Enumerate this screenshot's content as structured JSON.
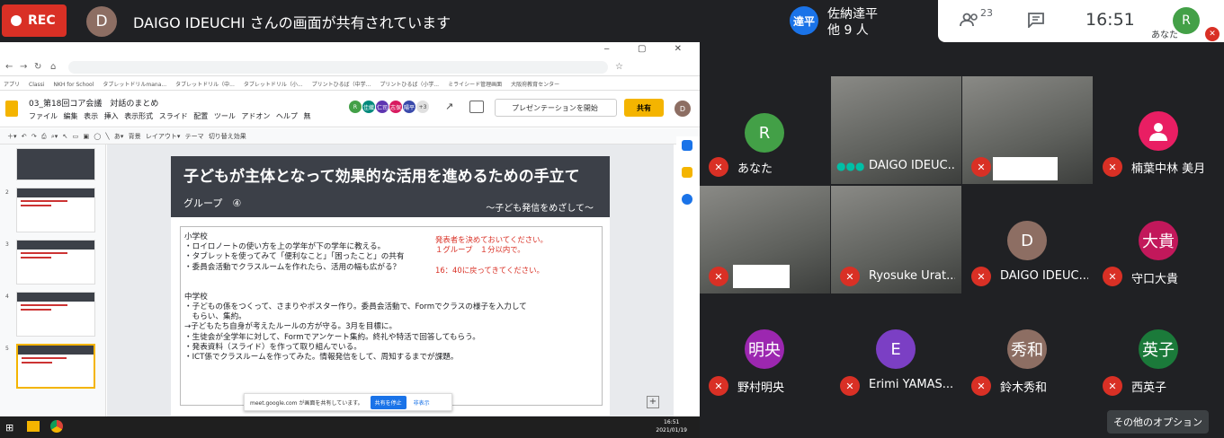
{
  "meet": {
    "rec_label": "REC",
    "presenter_initial": "D",
    "share_text": "DAIGO IDEUCHI さんの画面が共有されています",
    "pinned_badge": "達平",
    "pinned_name": "佐納達平",
    "pinned_others": "他 9 人",
    "people_count": "23",
    "clock": "16:51",
    "self_initial": "R",
    "self_label": "あなた",
    "more_options": "その他のオプション"
  },
  "browser": {
    "bookmarks": [
      "アプリ",
      "Classi",
      "NKH for School",
      "タブレットドリルmana...",
      "タブレットドリル（中...",
      "タブレットドリル（小...",
      "プリントひるば（中学...",
      "プリントひるば（小学...",
      "ミライシード管理画面",
      "大阪府教育センター"
    ]
  },
  "slides_app": {
    "doc_title": "03_第18回コア会議　対話のまとめ",
    "menu": [
      "ファイル",
      "編集",
      "表示",
      "挿入",
      "表示形式",
      "スライド",
      "配置",
      "ツール",
      "アドオン",
      "ヘルプ",
      "無"
    ],
    "collaborators": [
      "R",
      "佳織",
      "仁司",
      "志保",
      "陽平"
    ],
    "collab_extra": "+3",
    "present_label": "プレゼンテーションを開始",
    "share_label": "共有",
    "user_initial": "D",
    "toolbar": [
      "背景",
      "レイアウト▾",
      "テーマ",
      "切り替え効果"
    ],
    "slide_numbers": [
      "2",
      "3",
      "4",
      "5"
    ],
    "slide": {
      "title": "子どもが主体となって効果的な活用を進めるための手立て",
      "group": "グループ　④",
      "subtitle": "～子ども発信をめざして～",
      "body_lines": [
        "小学校",
        "・ロイロノートの使い方を上の学年が下の学年に教える。",
        "・タブレットを使ってみて「便利なこと」「困ったこと」の共有",
        "・委員会活動でクラスルームを作れたら、活用の幅も広がる？",
        "",
        "",
        "中学校",
        "・子どもの係をつくって、さまりやポスター作り。委員会活動で、Formでクラスの様子を入力して",
        "　もらい、集約。",
        "→子どもたち自身が考えたルールの方が守る。3月を目標に。",
        "・生徒会が全学年に対して、Formでアンケート集約。終礼や特活で回答してもらう。",
        "・発表資料（スライド）を作って取り組んでいる。",
        "・ICT係でクラスルームを作ってみた。情報発信をして、周知するまでが課題。"
      ],
      "red_note": "発表者を決めておいてください。\n１グループ　１分以内で。\n\n16：40に戻ってきてください。"
    },
    "share_notice": "meet.google.com が画面を共有しています。",
    "stop_label": "共有を停止",
    "hide_label": "非表示",
    "taskbar_time": "16:51",
    "taskbar_date": "2021/01/19"
  },
  "participants": [
    {
      "name": "あなた",
      "initial": "R",
      "color": "#43a047",
      "type": "avatar"
    },
    {
      "name": "DAIGO IDEUC...",
      "type": "video",
      "speaking": true
    },
    {
      "name": "",
      "type": "video",
      "redacted": true
    },
    {
      "name": "楠葉中林 美月",
      "initial": "",
      "color": "#e91e63",
      "type": "person-icon"
    },
    {
      "name": "",
      "type": "video",
      "redacted": true
    },
    {
      "name": "Ryosuke Urat...",
      "type": "video"
    },
    {
      "name": "DAIGO IDEUC...",
      "initial": "D",
      "color": "#8d6e63",
      "type": "avatar"
    },
    {
      "name": "守口大貴",
      "initial": "大貴",
      "color": "#c2185b",
      "type": "avatar"
    },
    {
      "name": "野村明央",
      "initial": "明央",
      "color": "#9c27b0",
      "type": "avatar"
    },
    {
      "name": "Erimi YAMAS...",
      "initial": "E",
      "color": "#7b3fc4",
      "type": "avatar"
    },
    {
      "name": "鈴木秀和",
      "initial": "秀和",
      "color": "#8d6e63",
      "type": "avatar"
    },
    {
      "name": "西英子",
      "initial": "英子",
      "color": "#1b7a3a",
      "type": "avatar"
    }
  ]
}
